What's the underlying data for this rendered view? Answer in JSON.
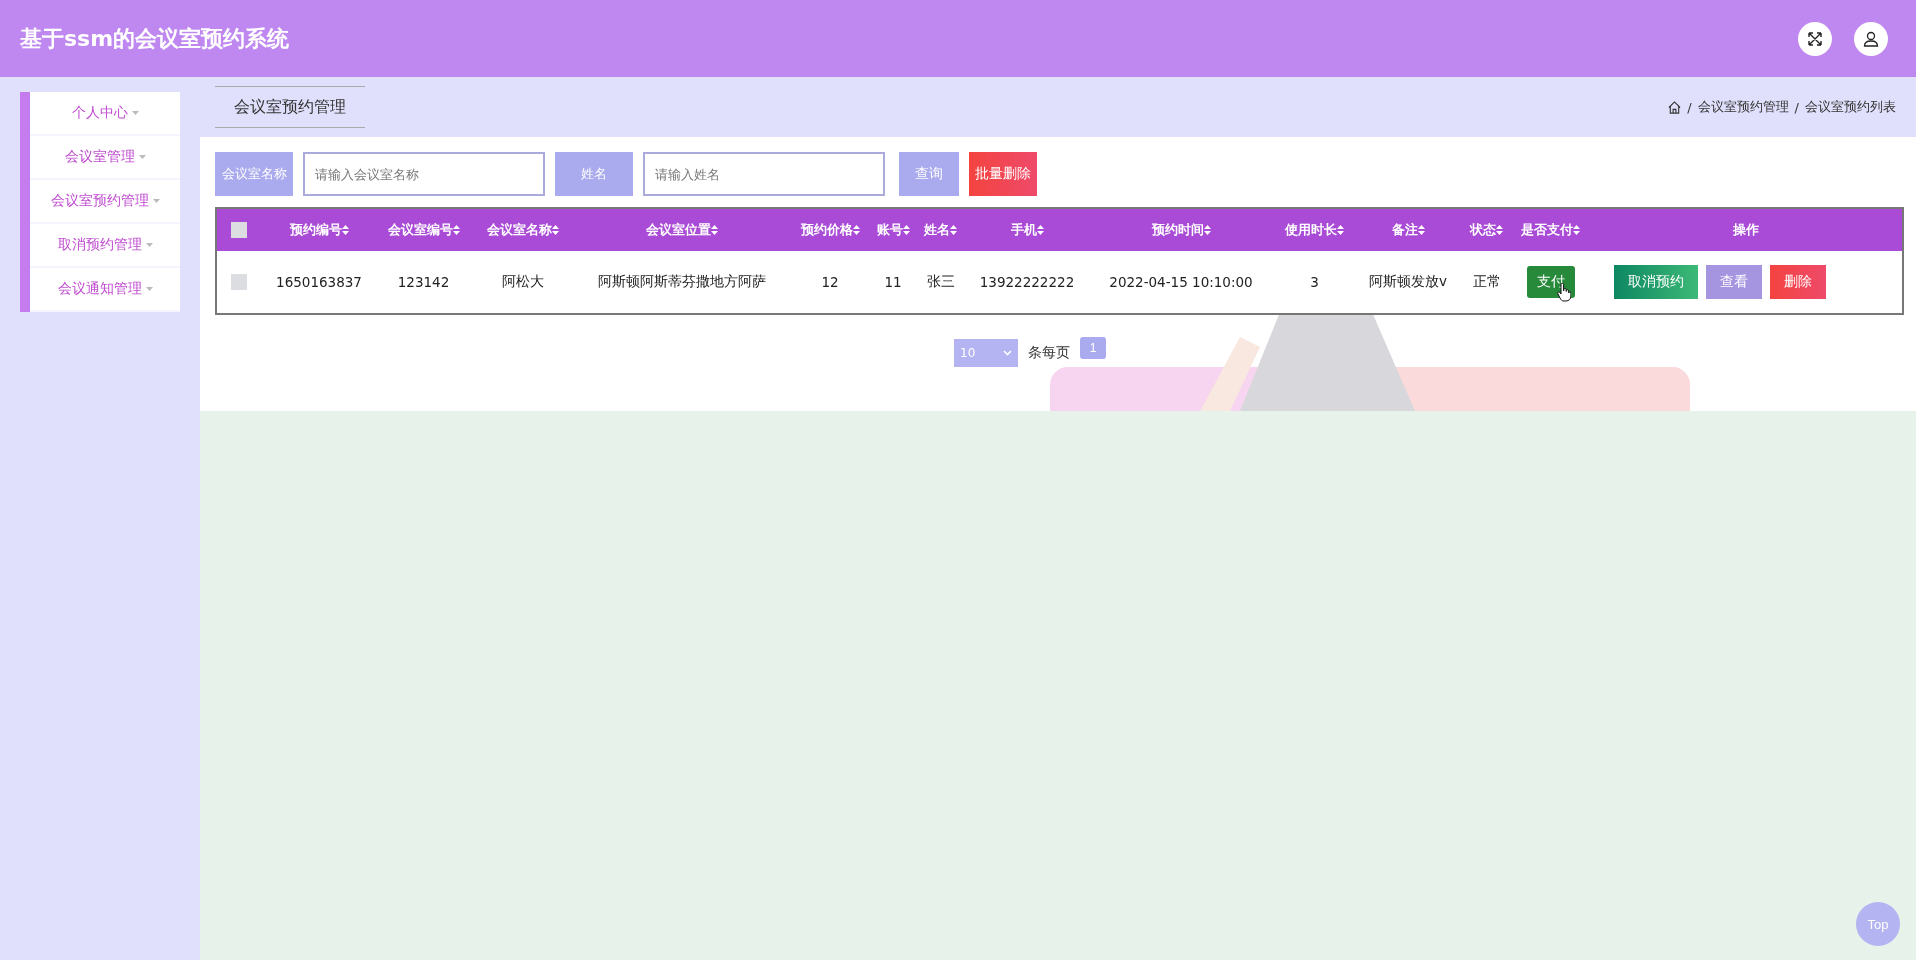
{
  "header": {
    "title": "基于ssm的会议室预约系统"
  },
  "sidebar": {
    "items": [
      {
        "label": "个人中心"
      },
      {
        "label": "会议室管理"
      },
      {
        "label": "会议室预约管理"
      },
      {
        "label": "取消预约管理"
      },
      {
        "label": "会议通知管理"
      }
    ]
  },
  "page_tab": {
    "label": "会议室预约管理"
  },
  "breadcrumb": [
    {
      "separator": "/",
      "label": "会议室预约管理"
    },
    {
      "separator": "/",
      "label": "会议室预约列表"
    }
  ],
  "search": {
    "fields": [
      {
        "label": "会议室名称",
        "placeholder": "请输入会议室名称"
      },
      {
        "label": "姓名",
        "placeholder": "请输入姓名"
      }
    ],
    "query_button": "查询",
    "batch_delete_button": "批量删除"
  },
  "table": {
    "select_all": {
      "checked": false
    },
    "columns": [
      {
        "label": "预约编号",
        "sortable": true
      },
      {
        "label": "会议室编号",
        "sortable": true
      },
      {
        "label": "会议室名称",
        "sortable": true
      },
      {
        "label": "会议室位置",
        "sortable": true
      },
      {
        "label": "预约价格",
        "sortable": true
      },
      {
        "label": "账号",
        "sortable": true
      },
      {
        "label": "姓名",
        "sortable": true
      },
      {
        "label": "手机",
        "sortable": true
      },
      {
        "label": "预约时间",
        "sortable": true
      },
      {
        "label": "使用时长",
        "sortable": true
      },
      {
        "label": "备注",
        "sortable": true
      },
      {
        "label": "状态",
        "sortable": true
      },
      {
        "label": "是否支付",
        "sortable": true
      },
      {
        "label": "操作",
        "sortable": false
      }
    ],
    "rows": [
      {
        "checked": false,
        "cells": [
          "1650163837",
          "123142",
          "阿松大",
          "阿斯顿阿斯蒂芬撒地方阿萨",
          "12",
          "11",
          "张三",
          "13922222222",
          "2022-04-15 10:10:00",
          "3",
          "阿斯顿发放v",
          "正常"
        ],
        "pay_button": "支付",
        "actions": [
          {
            "kind": "cancel",
            "label": "取消预约"
          },
          {
            "kind": "view",
            "label": "查看"
          },
          {
            "kind": "delete",
            "label": "删除"
          }
        ]
      }
    ]
  },
  "pagination": {
    "page_size": "10",
    "page_size_label": "条每页",
    "pages": [
      {
        "label": "1",
        "selected": true
      }
    ]
  },
  "back_to_top": "Top"
}
